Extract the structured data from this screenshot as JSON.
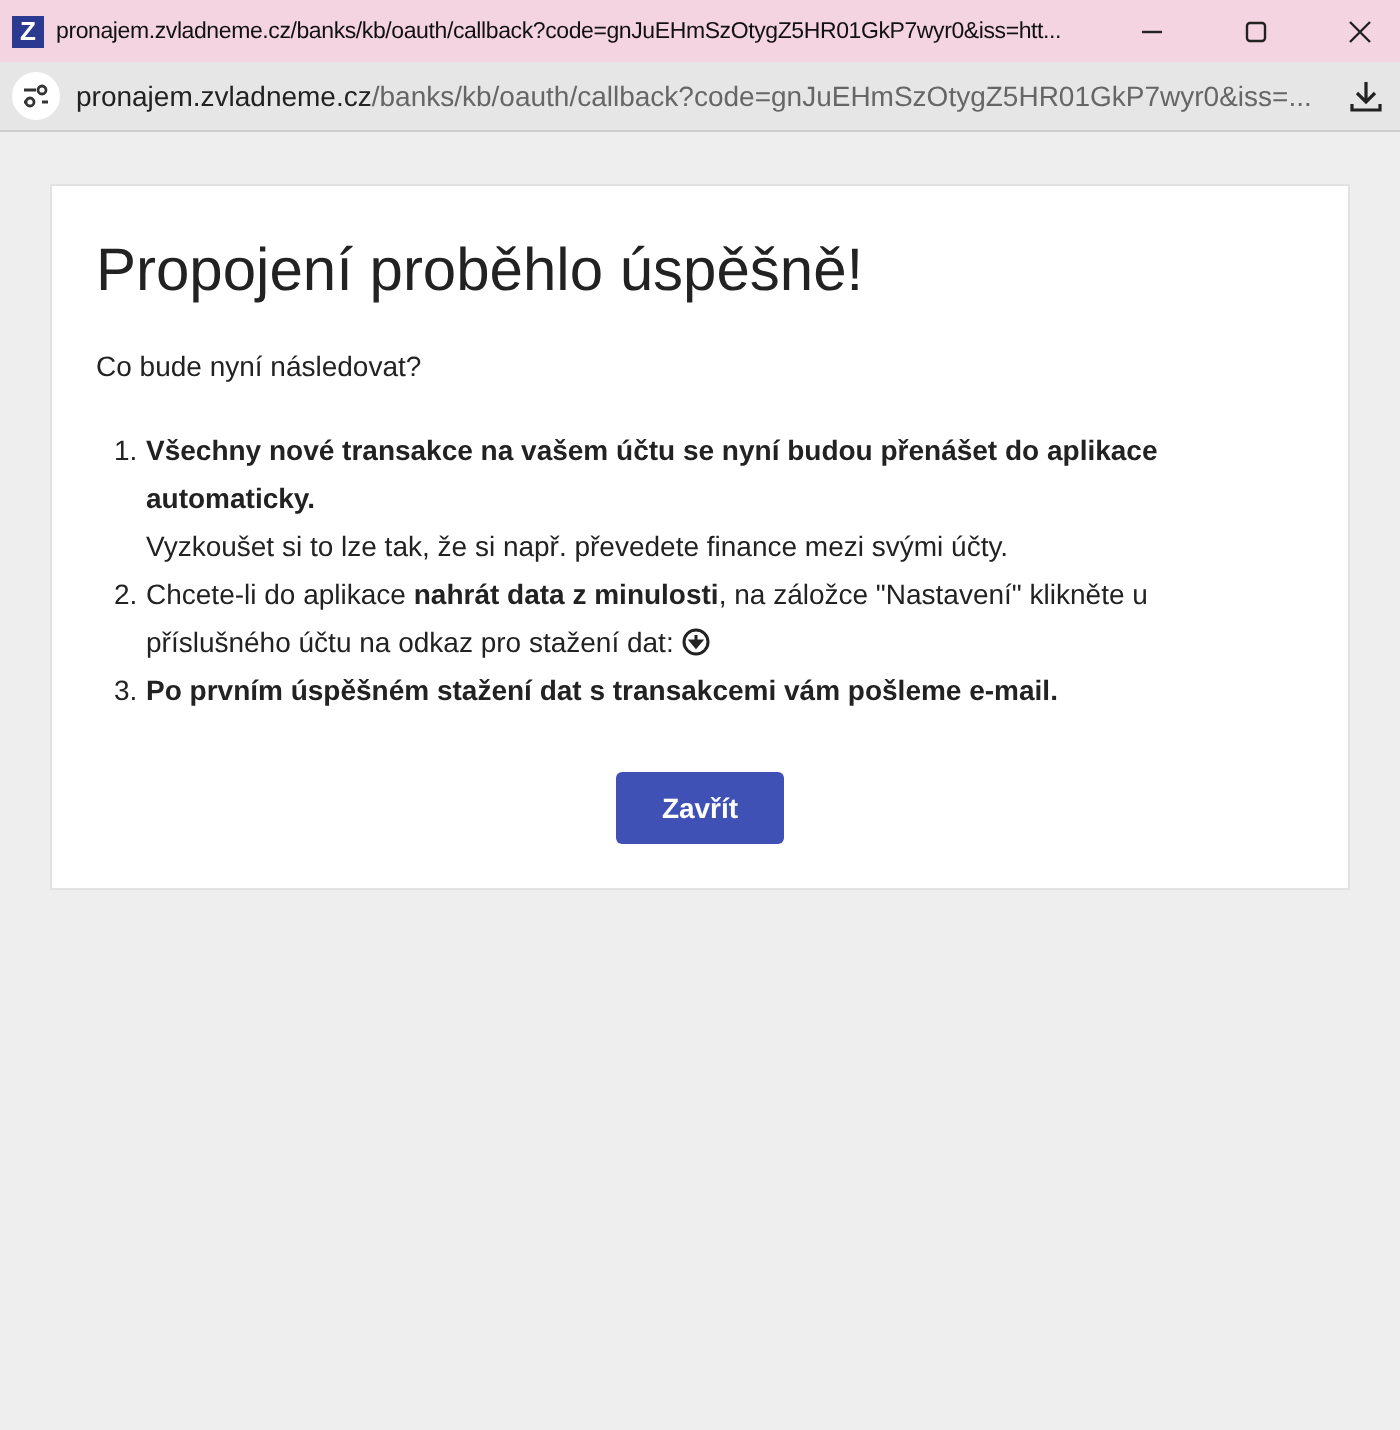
{
  "window": {
    "title": "pronajem.zvladneme.cz/banks/kb/oauth/callback?code=gnJuEHmSzOtygZ5HR01GkP7wyr0&iss=htt...",
    "logo": "Z"
  },
  "address_bar": {
    "host": "pronajem.zvladneme.cz",
    "path": "/banks/kb/oauth/callback?code=gnJuEHmSzOtygZ5HR01GkP7wyr0&iss=..."
  },
  "card": {
    "heading": "Propojení proběhlo úspěšně!",
    "intro": "Co bude nyní následovat?",
    "steps": [
      {
        "number": "1.",
        "text": "Všechny nové transakce na vašem účtu se nyní budou přenášet do aplikace automaticky.",
        "bold": true,
        "note": "Vyzkoušet si to lze tak, že si např. převedete finance mezi svými účty."
      },
      {
        "number": "2.",
        "text": "Chcete-li do aplikace **nahrát data z minulosti**, na záložce \"Nastavení\" klikněte u příslušného účtu na odkaz pro stažení dat:",
        "bold": false,
        "download_icon": true
      },
      {
        "number": "3.",
        "text": "Po prvním úspěšném stažení dat s transakcemi vám pošleme e-mail.",
        "bold": true
      }
    ],
    "button": "Zavřít"
  }
}
